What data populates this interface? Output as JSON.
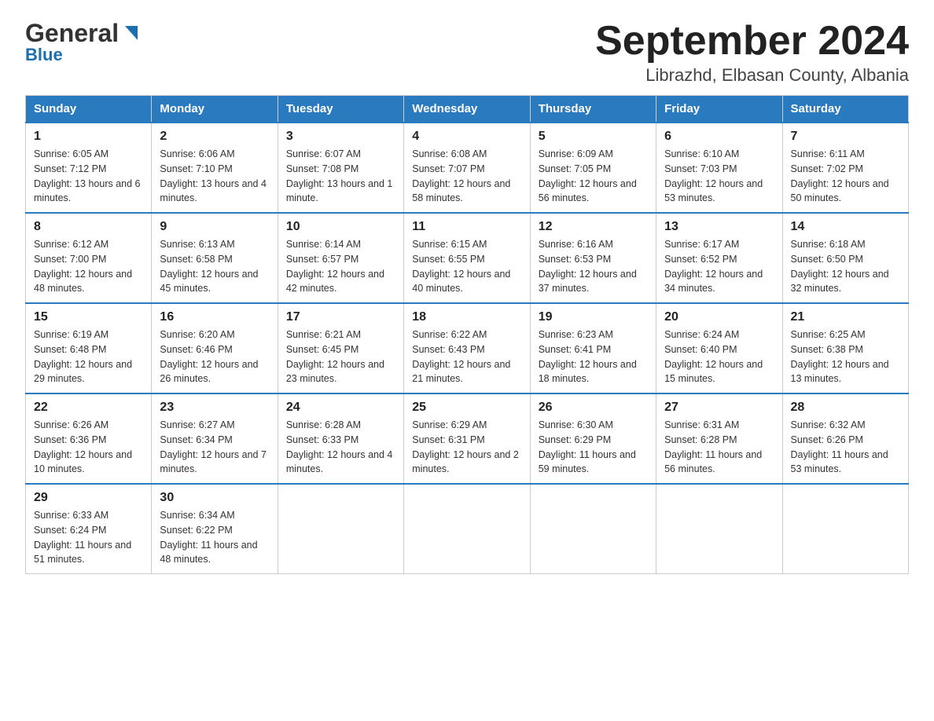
{
  "header": {
    "logo_general": "General",
    "logo_blue": "Blue",
    "month_title": "September 2024",
    "location": "Librazhd, Elbasan County, Albania"
  },
  "weekdays": [
    "Sunday",
    "Monday",
    "Tuesday",
    "Wednesday",
    "Thursday",
    "Friday",
    "Saturday"
  ],
  "weeks": [
    [
      {
        "day": "1",
        "sunrise": "Sunrise: 6:05 AM",
        "sunset": "Sunset: 7:12 PM",
        "daylight": "Daylight: 13 hours and 6 minutes."
      },
      {
        "day": "2",
        "sunrise": "Sunrise: 6:06 AM",
        "sunset": "Sunset: 7:10 PM",
        "daylight": "Daylight: 13 hours and 4 minutes."
      },
      {
        "day": "3",
        "sunrise": "Sunrise: 6:07 AM",
        "sunset": "Sunset: 7:08 PM",
        "daylight": "Daylight: 13 hours and 1 minute."
      },
      {
        "day": "4",
        "sunrise": "Sunrise: 6:08 AM",
        "sunset": "Sunset: 7:07 PM",
        "daylight": "Daylight: 12 hours and 58 minutes."
      },
      {
        "day": "5",
        "sunrise": "Sunrise: 6:09 AM",
        "sunset": "Sunset: 7:05 PM",
        "daylight": "Daylight: 12 hours and 56 minutes."
      },
      {
        "day": "6",
        "sunrise": "Sunrise: 6:10 AM",
        "sunset": "Sunset: 7:03 PM",
        "daylight": "Daylight: 12 hours and 53 minutes."
      },
      {
        "day": "7",
        "sunrise": "Sunrise: 6:11 AM",
        "sunset": "Sunset: 7:02 PM",
        "daylight": "Daylight: 12 hours and 50 minutes."
      }
    ],
    [
      {
        "day": "8",
        "sunrise": "Sunrise: 6:12 AM",
        "sunset": "Sunset: 7:00 PM",
        "daylight": "Daylight: 12 hours and 48 minutes."
      },
      {
        "day": "9",
        "sunrise": "Sunrise: 6:13 AM",
        "sunset": "Sunset: 6:58 PM",
        "daylight": "Daylight: 12 hours and 45 minutes."
      },
      {
        "day": "10",
        "sunrise": "Sunrise: 6:14 AM",
        "sunset": "Sunset: 6:57 PM",
        "daylight": "Daylight: 12 hours and 42 minutes."
      },
      {
        "day": "11",
        "sunrise": "Sunrise: 6:15 AM",
        "sunset": "Sunset: 6:55 PM",
        "daylight": "Daylight: 12 hours and 40 minutes."
      },
      {
        "day": "12",
        "sunrise": "Sunrise: 6:16 AM",
        "sunset": "Sunset: 6:53 PM",
        "daylight": "Daylight: 12 hours and 37 minutes."
      },
      {
        "day": "13",
        "sunrise": "Sunrise: 6:17 AM",
        "sunset": "Sunset: 6:52 PM",
        "daylight": "Daylight: 12 hours and 34 minutes."
      },
      {
        "day": "14",
        "sunrise": "Sunrise: 6:18 AM",
        "sunset": "Sunset: 6:50 PM",
        "daylight": "Daylight: 12 hours and 32 minutes."
      }
    ],
    [
      {
        "day": "15",
        "sunrise": "Sunrise: 6:19 AM",
        "sunset": "Sunset: 6:48 PM",
        "daylight": "Daylight: 12 hours and 29 minutes."
      },
      {
        "day": "16",
        "sunrise": "Sunrise: 6:20 AM",
        "sunset": "Sunset: 6:46 PM",
        "daylight": "Daylight: 12 hours and 26 minutes."
      },
      {
        "day": "17",
        "sunrise": "Sunrise: 6:21 AM",
        "sunset": "Sunset: 6:45 PM",
        "daylight": "Daylight: 12 hours and 23 minutes."
      },
      {
        "day": "18",
        "sunrise": "Sunrise: 6:22 AM",
        "sunset": "Sunset: 6:43 PM",
        "daylight": "Daylight: 12 hours and 21 minutes."
      },
      {
        "day": "19",
        "sunrise": "Sunrise: 6:23 AM",
        "sunset": "Sunset: 6:41 PM",
        "daylight": "Daylight: 12 hours and 18 minutes."
      },
      {
        "day": "20",
        "sunrise": "Sunrise: 6:24 AM",
        "sunset": "Sunset: 6:40 PM",
        "daylight": "Daylight: 12 hours and 15 minutes."
      },
      {
        "day": "21",
        "sunrise": "Sunrise: 6:25 AM",
        "sunset": "Sunset: 6:38 PM",
        "daylight": "Daylight: 12 hours and 13 minutes."
      }
    ],
    [
      {
        "day": "22",
        "sunrise": "Sunrise: 6:26 AM",
        "sunset": "Sunset: 6:36 PM",
        "daylight": "Daylight: 12 hours and 10 minutes."
      },
      {
        "day": "23",
        "sunrise": "Sunrise: 6:27 AM",
        "sunset": "Sunset: 6:34 PM",
        "daylight": "Daylight: 12 hours and 7 minutes."
      },
      {
        "day": "24",
        "sunrise": "Sunrise: 6:28 AM",
        "sunset": "Sunset: 6:33 PM",
        "daylight": "Daylight: 12 hours and 4 minutes."
      },
      {
        "day": "25",
        "sunrise": "Sunrise: 6:29 AM",
        "sunset": "Sunset: 6:31 PM",
        "daylight": "Daylight: 12 hours and 2 minutes."
      },
      {
        "day": "26",
        "sunrise": "Sunrise: 6:30 AM",
        "sunset": "Sunset: 6:29 PM",
        "daylight": "Daylight: 11 hours and 59 minutes."
      },
      {
        "day": "27",
        "sunrise": "Sunrise: 6:31 AM",
        "sunset": "Sunset: 6:28 PM",
        "daylight": "Daylight: 11 hours and 56 minutes."
      },
      {
        "day": "28",
        "sunrise": "Sunrise: 6:32 AM",
        "sunset": "Sunset: 6:26 PM",
        "daylight": "Daylight: 11 hours and 53 minutes."
      }
    ],
    [
      {
        "day": "29",
        "sunrise": "Sunrise: 6:33 AM",
        "sunset": "Sunset: 6:24 PM",
        "daylight": "Daylight: 11 hours and 51 minutes."
      },
      {
        "day": "30",
        "sunrise": "Sunrise: 6:34 AM",
        "sunset": "Sunset: 6:22 PM",
        "daylight": "Daylight: 11 hours and 48 minutes."
      },
      null,
      null,
      null,
      null,
      null
    ]
  ]
}
